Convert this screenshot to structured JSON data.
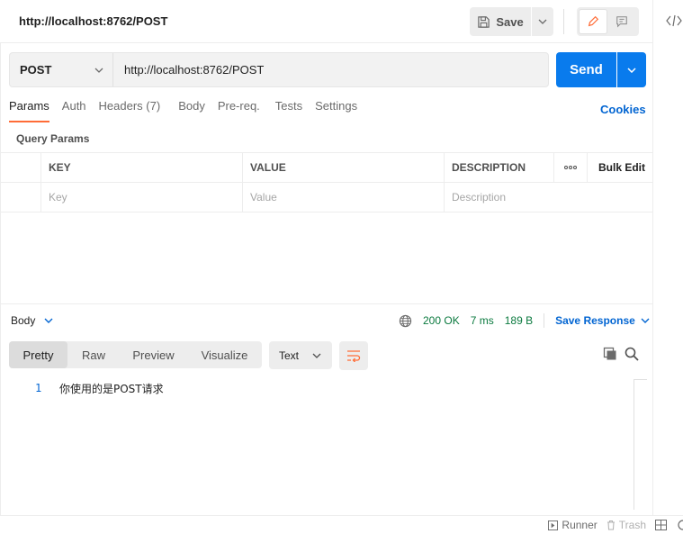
{
  "tab": {
    "title": "http://localhost:8762/POST"
  },
  "toolbar": {
    "save_label": "Save"
  },
  "request": {
    "method": "POST",
    "url": "http://localhost:8762/POST",
    "send_label": "Send"
  },
  "request_tabs": [
    {
      "label": "Params",
      "active": true
    },
    {
      "label": "Auth"
    },
    {
      "label": "Headers (7)"
    },
    {
      "label": "Body"
    },
    {
      "label": "Pre-req."
    },
    {
      "label": "Tests"
    },
    {
      "label": "Settings"
    }
  ],
  "cookies_label": "Cookies",
  "query_params": {
    "title": "Query Params",
    "headers": {
      "key": "KEY",
      "value": "VALUE",
      "description": "DESCRIPTION",
      "bulk_edit": "Bulk Edit"
    },
    "placeholders": {
      "key": "Key",
      "value": "Value",
      "description": "Description"
    }
  },
  "response": {
    "body_label": "Body",
    "status": "200 OK",
    "time": "7 ms",
    "size": "189 B",
    "save_response_label": "Save Response",
    "views": [
      "Pretty",
      "Raw",
      "Preview",
      "Visualize"
    ],
    "active_view": "Pretty",
    "format": "Text",
    "lines": [
      {
        "num": "1",
        "text": "你使用的是POST请求"
      }
    ]
  },
  "statusbar": {
    "runner": "Runner",
    "trash": "Trash"
  },
  "colors": {
    "accent": "#ff6c37",
    "primary": "#097bed",
    "link": "#0265d2",
    "success": "#0b7a3f"
  }
}
